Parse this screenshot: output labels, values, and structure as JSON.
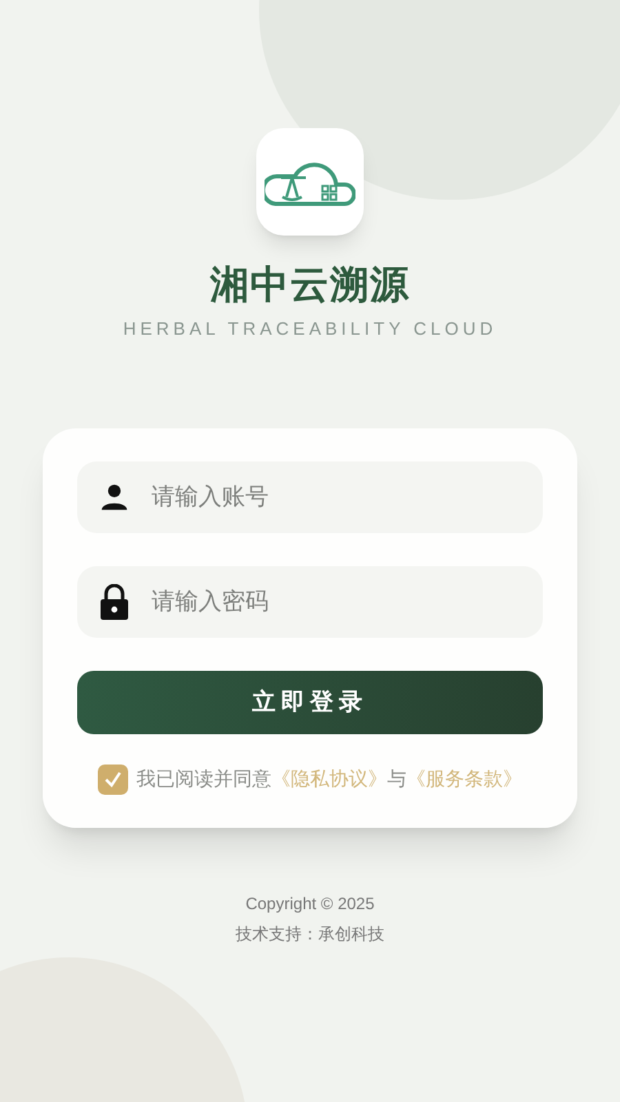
{
  "app": {
    "title": "湘中云溯源",
    "subtitle": "HERBAL TRACEABILITY CLOUD"
  },
  "form": {
    "fields": [
      {
        "kind": "account",
        "placeholder": "请输入账号"
      },
      {
        "kind": "password",
        "placeholder": "请输入密码"
      }
    ],
    "submit": "立即登录",
    "agreement": {
      "checked": true,
      "text": "我已阅读并同意",
      "links": [
        "《隐私协议》",
        "《服务条款》"
      ],
      "joiner": "与"
    }
  },
  "footer": {
    "copyright": "Copyright © 2025",
    "support": "技术支持：承创科技"
  }
}
